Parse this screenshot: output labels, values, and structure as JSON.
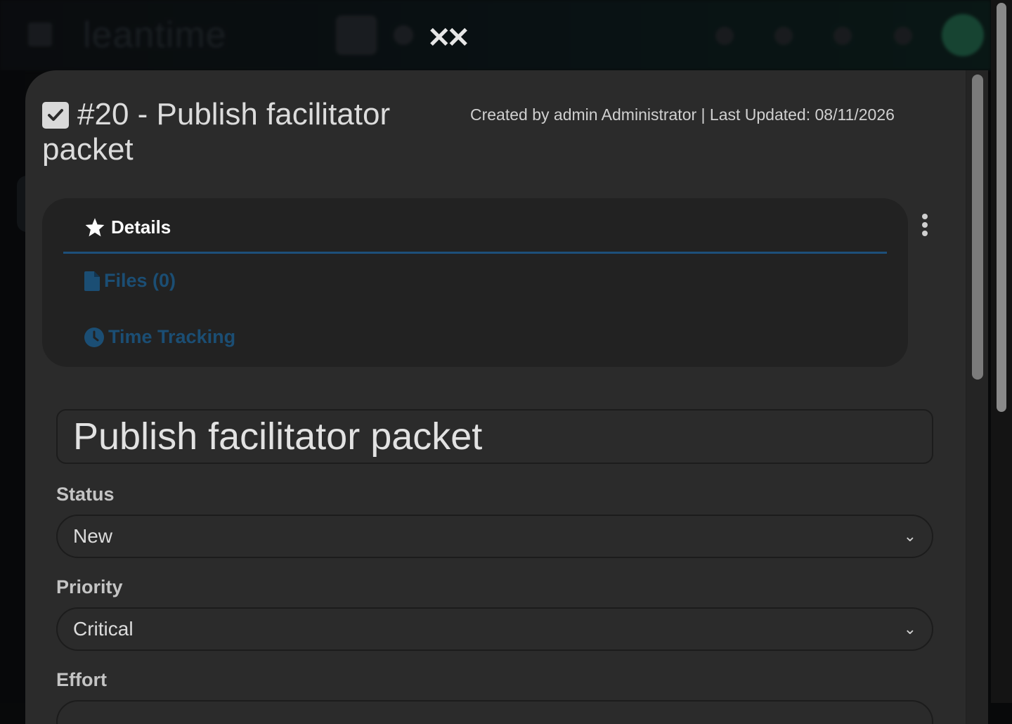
{
  "background": {
    "logo_text": "leantime"
  },
  "close_icon": "double-x-close-icon",
  "ticket": {
    "heading": "#20 - Publish facilitator packet",
    "meta": "Created by admin Administrator | Last Updated: 08/11/2026"
  },
  "tabs": {
    "details": "Details",
    "files": "Files (0)",
    "time_tracking": "Time Tracking"
  },
  "form": {
    "title_value": "Publish facilitator packet",
    "status_label": "Status",
    "status_value": "New",
    "priority_label": "Priority",
    "priority_value": "Critical",
    "effort_label": "Effort"
  },
  "colors": {
    "modal_bg": "#2b2b2b",
    "tab_panel_bg": "#222222",
    "accent_blue": "#1d4f7a"
  }
}
